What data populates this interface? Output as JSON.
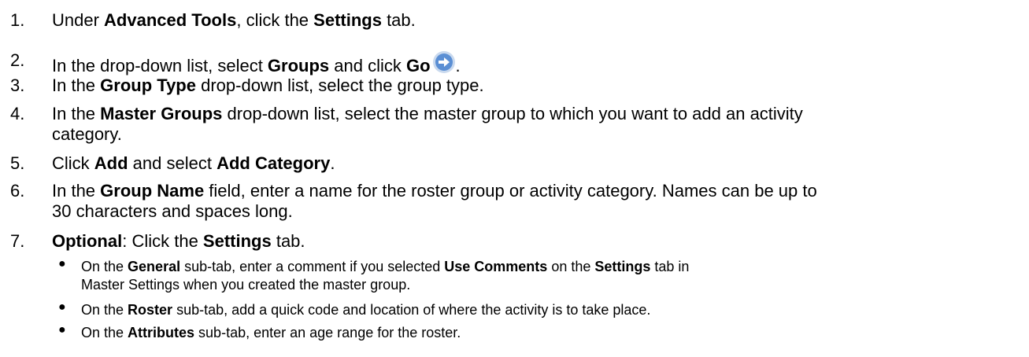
{
  "steps": [
    {
      "num": "1.",
      "p1": "Under ",
      "b1": "Advanced Tools",
      "p2": ", click the ",
      "b2": "Settings",
      "p3": " tab."
    },
    {
      "num": "2.",
      "p1": "In the drop-down list, select ",
      "b1": "Groups",
      "p2": " and click ",
      "b2": "Go",
      "p3": ".",
      "icon": "go-arrow-icon"
    },
    {
      "num": "3.",
      "p1": "In the ",
      "b1": "Group Type",
      "p2": " drop-down list, select the group type."
    },
    {
      "num": "4.",
      "p1": "In the ",
      "b1": "Master Groups",
      "p2": " drop-down list, select the master group to which you want to add an activity",
      "p3": "category."
    },
    {
      "num": "5.",
      "p1": "Click ",
      "b1": "Add",
      "p2": " and select ",
      "b2": "Add Category",
      "p3": "."
    },
    {
      "num": "6.",
      "p1": "In the ",
      "b1": "Group Name",
      "p2": " field, enter a name for the roster group or activity category. Names can be up to",
      "p3": "30 characters and spaces long."
    },
    {
      "num": "7.",
      "b1": "Optional",
      "p1": ": Click the ",
      "b2": "Settings",
      "p2": " tab."
    }
  ],
  "subitems": [
    {
      "p1": "On the ",
      "b1": "General",
      "p2": " sub-tab, enter a comment if you selected ",
      "b2": "Use Comments",
      "p3": " on the ",
      "b3": "Settings",
      "p4": " tab in",
      "p5": "Master Settings when you created the master group."
    },
    {
      "p1": "On the ",
      "b1": "Roster",
      "p2": " sub-tab, add a quick code and location of where the activity is to take place."
    },
    {
      "p1": "On the ",
      "b1": "Attributes",
      "p2": " sub-tab, enter an age range for the roster."
    }
  ],
  "colors": {
    "go_icon_fill": "#5b8fd4",
    "go_icon_ring": "#c9d9ee"
  }
}
